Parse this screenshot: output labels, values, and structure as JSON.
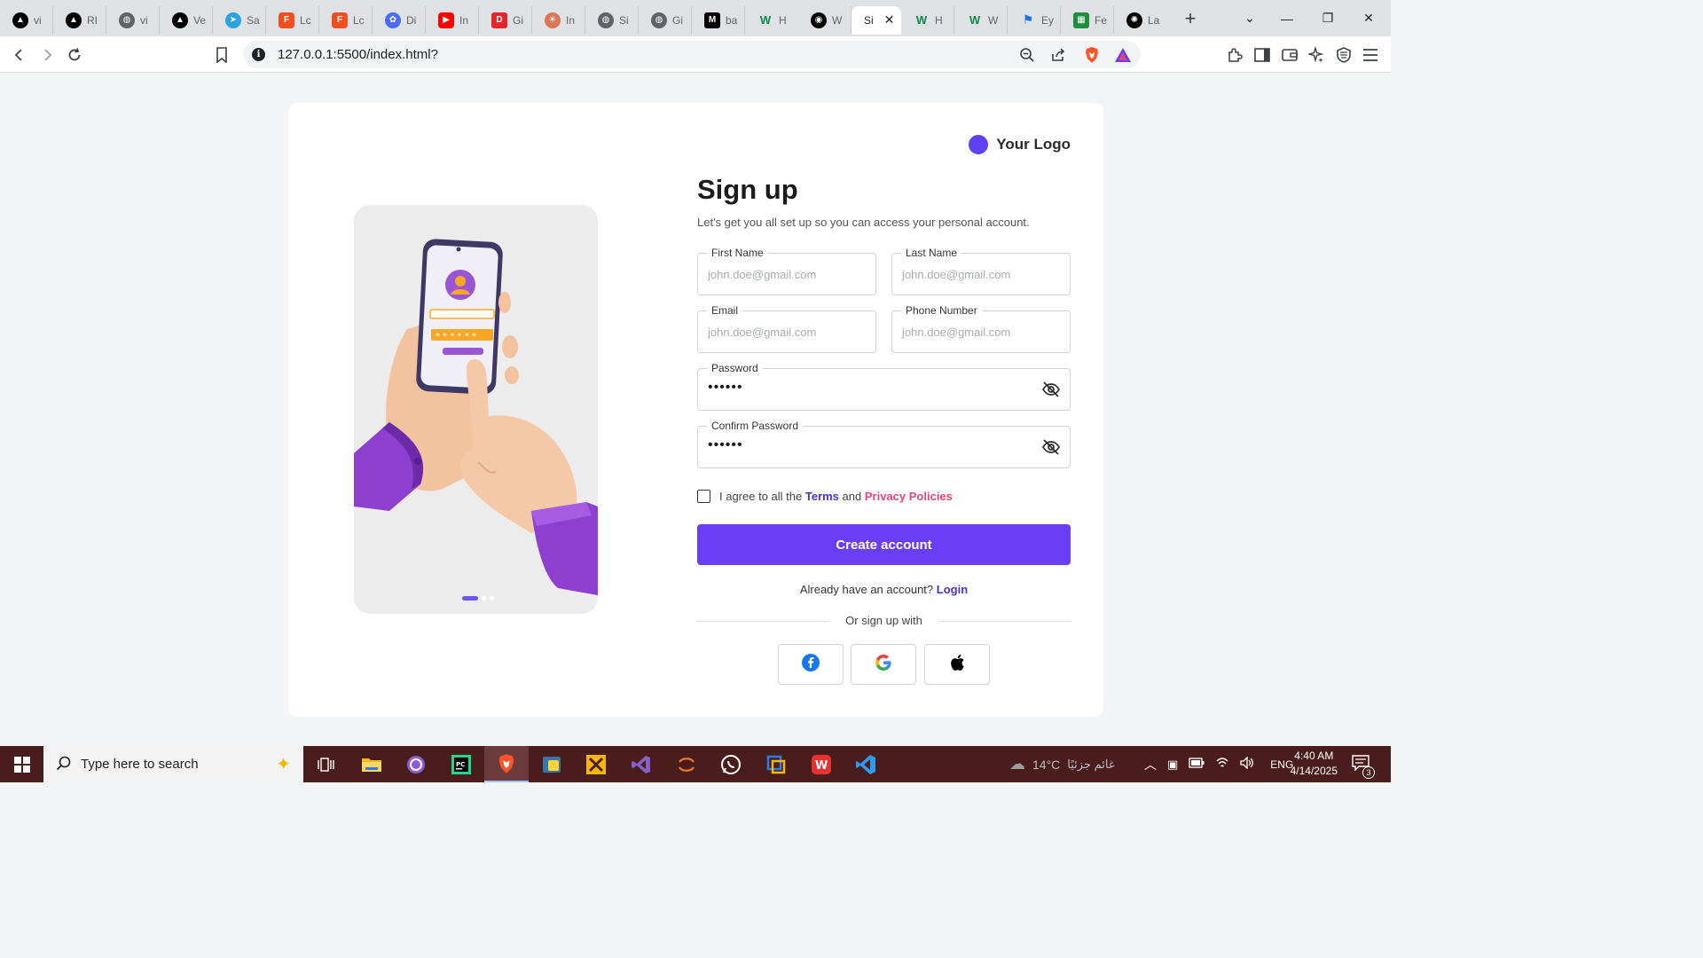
{
  "browser": {
    "tabs": [
      {
        "label": "vi",
        "icon": "vercel-icon",
        "color": "#000000"
      },
      {
        "label": "RI",
        "icon": "vercel-icon",
        "color": "#000000"
      },
      {
        "label": "vi",
        "icon": "globe-icon",
        "color": "#5f6368"
      },
      {
        "label": "Ve",
        "icon": "vercel-icon",
        "color": "#000000"
      },
      {
        "label": "Sa",
        "icon": "telegram-icon",
        "color": "#2aa3e0"
      },
      {
        "label": "Lc",
        "icon": "figma-icon",
        "color": "#f24e1e"
      },
      {
        "label": "Lc",
        "icon": "figma-icon",
        "color": "#f24e1e"
      },
      {
        "label": "Di",
        "icon": "dribbble-icon",
        "color": "#4a6cf7"
      },
      {
        "label": "In",
        "icon": "youtube-icon",
        "color": "#ff0000"
      },
      {
        "label": "Gi",
        "icon": "app-icon",
        "color": "#e5252a"
      },
      {
        "label": "In",
        "icon": "claude-icon",
        "color": "#d97757"
      },
      {
        "label": "Si",
        "icon": "globe-icon",
        "color": "#5f6368"
      },
      {
        "label": "Gi",
        "icon": "globe-icon",
        "color": "#5f6368"
      },
      {
        "label": "ba",
        "icon": "m-icon",
        "color": "#000000"
      },
      {
        "label": "H",
        "icon": "w-icon",
        "color": "#0b8a4a"
      },
      {
        "label": "W",
        "icon": "github-icon",
        "color": "#000000"
      },
      {
        "label": "Si",
        "icon": "page-icon",
        "color": "#5f6368",
        "active": true
      },
      {
        "label": "H",
        "icon": "w-icon",
        "color": "#0b8a4a"
      },
      {
        "label": "W",
        "icon": "w-icon",
        "color": "#0b8a4a"
      },
      {
        "label": "Ey",
        "icon": "flag-icon",
        "color": "#1a73e8"
      },
      {
        "label": "Fe",
        "icon": "sheet-icon",
        "color": "#1e8e3e"
      },
      {
        "label": "La",
        "icon": "openai-icon",
        "color": "#000000"
      }
    ],
    "url": "127.0.0.1:5500/index.html?"
  },
  "page": {
    "logo_text": "Your Logo",
    "title": "Sign up",
    "subtitle": "Let's get you all set up so you can access your personal account.",
    "fields": {
      "first_name": {
        "label": "First Name",
        "placeholder": "john.doe@gmail.com"
      },
      "last_name": {
        "label": "Last Name",
        "placeholder": "john.doe@gmail.com"
      },
      "email": {
        "label": "Email",
        "placeholder": "john.doe@gmail.com"
      },
      "phone": {
        "label": "Phone Number",
        "placeholder": "john.doe@gmail.com"
      },
      "password": {
        "label": "Password",
        "value": "••••••"
      },
      "confirm_password": {
        "label": "Confirm Password",
        "value": "••••••"
      }
    },
    "agree": {
      "prefix": "I agree to all the",
      "terms": "Terms",
      "and": "and",
      "privacy": "Privacy Policies"
    },
    "create_button": "Create account",
    "already": {
      "text": "Already have an account?",
      "login": "Login"
    },
    "divider_text": "Or sign up with",
    "social": [
      "facebook-icon",
      "google-icon",
      "apple-icon"
    ],
    "colors": {
      "accent": "#6a3ef5",
      "link": "#4b32c3",
      "privacy": "#e0457b"
    }
  },
  "taskbar": {
    "search_placeholder": "Type here to search",
    "weather": "14°C",
    "weather_text": "غائم جزئيًا",
    "language": "ENG",
    "time": "4:40 AM",
    "date": "4/14/2025",
    "notifications": "3"
  }
}
